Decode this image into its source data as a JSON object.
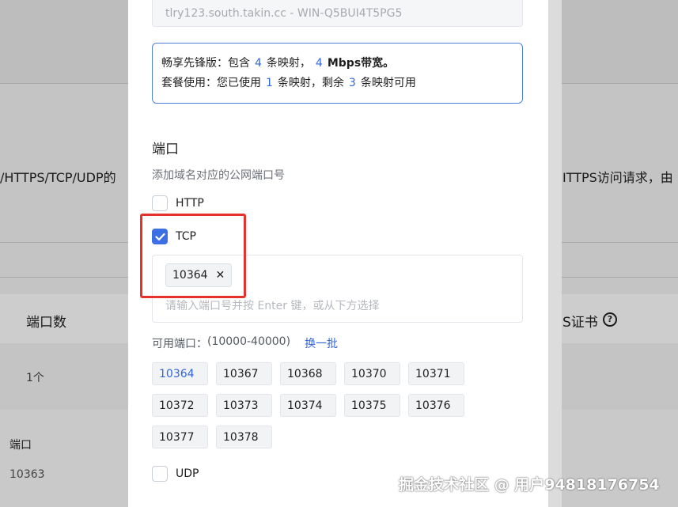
{
  "background": {
    "left_text": "/HTTPS/TCP/UDP的",
    "right_text": "ITTPS访问请求，由",
    "table": {
      "col_ports_header": "端口数",
      "col_cert_header": "S证书",
      "row_ports_value": "1个"
    },
    "lower": {
      "port_label": "端口",
      "port_value": "10363"
    }
  },
  "modal": {
    "host_value": "tlry123.south.takin.cc - WIN-Q5BUI4T5PG5",
    "plan": {
      "line1_prefix": "畅享先锋版：包含",
      "mapping_count": "4",
      "line1_mid": "条映射，",
      "bandwidth": "4",
      "line1_suffix": "Mbps带宽。",
      "line2_prefix": "套餐使用：您已使用",
      "used": "1",
      "line2_mid": "条映射，剩余",
      "remaining": "3",
      "line2_suffix": "条映射可用"
    },
    "ports_section": {
      "title": "端口",
      "description": "添加域名对应的公网端口号",
      "http_label": "HTTP",
      "tcp_label": "TCP",
      "udp_label": "UDP",
      "http_checked": false,
      "tcp_checked": true,
      "udp_checked": false,
      "tcp_tags": [
        "10364"
      ],
      "tag_input_placeholder": "请输入端口号并按 Enter 键，或从下方选择",
      "available_label": "可用端口：",
      "available_range": "(10000-40000)",
      "refresh_label": "换一批",
      "available_ports": [
        "10364",
        "10367",
        "10368",
        "10370",
        "10371",
        "10372",
        "10373",
        "10374",
        "10375",
        "10376",
        "10377",
        "10378"
      ],
      "selected_port": "10364"
    }
  },
  "watermark": "掘金技术社区 @ 用户94818176754",
  "colors": {
    "accent": "#3366dd",
    "checkbox_checked": "#3b6fe3",
    "highlight": "#e5322b"
  }
}
